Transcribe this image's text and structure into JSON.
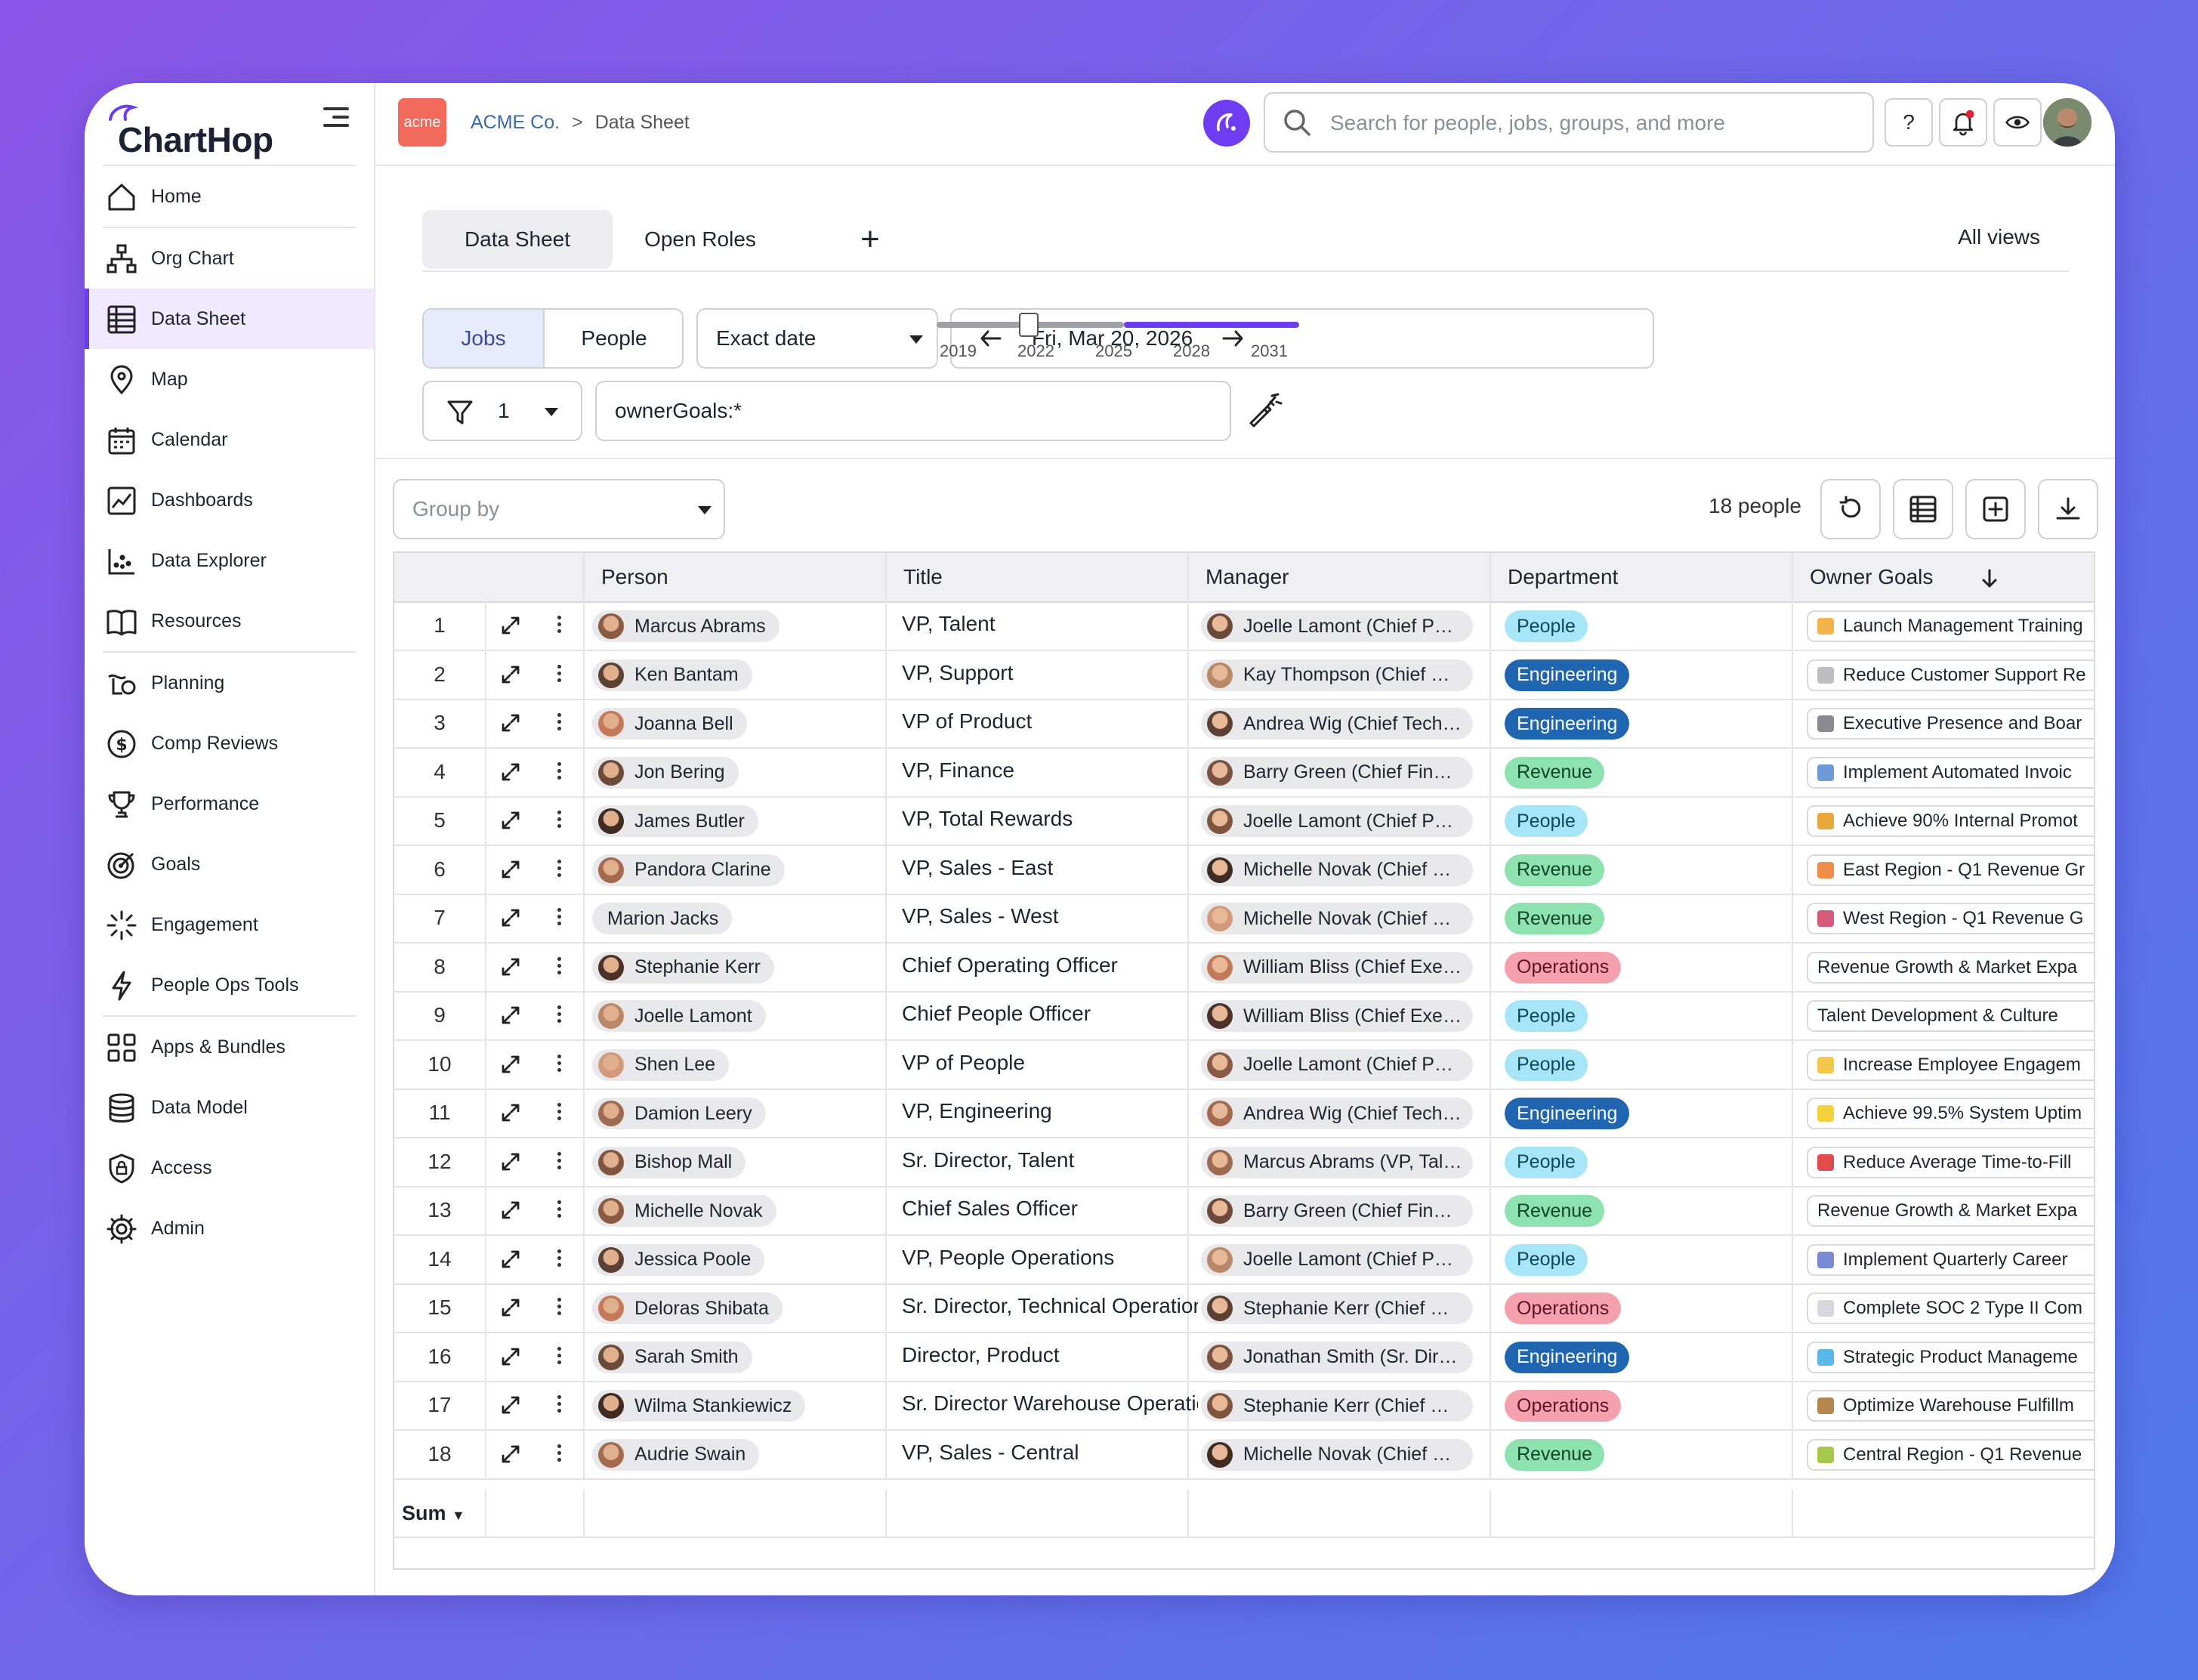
{
  "app": {
    "name": "ChartHop"
  },
  "sidebar": {
    "items": [
      {
        "label": "Home",
        "icon": "home-icon"
      },
      {
        "label": "Org Chart",
        "icon": "org-chart-icon"
      },
      {
        "label": "Data Sheet",
        "icon": "data-sheet-icon",
        "active": true
      },
      {
        "label": "Map",
        "icon": "map-pin-icon"
      },
      {
        "label": "Calendar",
        "icon": "calendar-icon"
      },
      {
        "label": "Dashboards",
        "icon": "dashboards-icon"
      },
      {
        "label": "Data Explorer",
        "icon": "data-explorer-icon"
      },
      {
        "label": "Resources",
        "icon": "book-icon"
      },
      {
        "label": "Planning",
        "icon": "planning-icon"
      },
      {
        "label": "Comp Reviews",
        "icon": "dollar-icon"
      },
      {
        "label": "Performance",
        "icon": "trophy-icon"
      },
      {
        "label": "Goals",
        "icon": "target-icon"
      },
      {
        "label": "Engagement",
        "icon": "engagement-icon"
      },
      {
        "label": "People Ops Tools",
        "icon": "lightning-icon"
      },
      {
        "label": "Apps & Bundles",
        "icon": "apps-icon"
      },
      {
        "label": "Data Model",
        "icon": "database-icon"
      },
      {
        "label": "Access",
        "icon": "shield-icon"
      },
      {
        "label": "Admin",
        "icon": "gear-icon"
      }
    ]
  },
  "header": {
    "org_logo_text": "acme",
    "breadcrumb_org": "ACME Co.",
    "breadcrumb_sep": ">",
    "breadcrumb_page": "Data Sheet",
    "search_placeholder": "Search for people, jobs, groups, and more",
    "help_label": "?"
  },
  "tabs": {
    "items": [
      "Data Sheet",
      "Open Roles"
    ],
    "add_label": "+",
    "all_views": "All views"
  },
  "controls": {
    "mode_jobs": "Jobs",
    "mode_people": "People",
    "date_mode": "Exact date",
    "date_value": "Fri, Mar 20, 2026",
    "timeline_years": [
      "2019",
      "2022",
      "2025",
      "2028",
      "2031"
    ],
    "filter_count": "1",
    "query": "ownerGoals:*",
    "group_by_placeholder": "Group by",
    "people_count": "18 people"
  },
  "table": {
    "columns": [
      "Person",
      "Title",
      "Manager",
      "Department",
      "Owner Goals"
    ],
    "sum_label": "Sum",
    "rows": [
      {
        "n": "1",
        "person": "Marcus Abrams",
        "title": "VP, Talent",
        "manager": "Joelle Lamont (Chief People Officer)",
        "dept": "People",
        "goal": "📈 Launch Management Training"
      },
      {
        "n": "2",
        "person": "Ken Bantam",
        "title": "VP, Support",
        "manager": "Kay Thompson (Chief Customer Officer)",
        "dept": "Engineering",
        "goal": "⏱ Reduce Customer Support Re"
      },
      {
        "n": "3",
        "person": "Joanna Bell",
        "title": "VP of Product",
        "manager": "Andrea Wig (Chief Technology Officer)",
        "dept": "Engineering",
        "goal": "🎤 Executive Presence and Boar"
      },
      {
        "n": "4",
        "person": "Jon Bering",
        "title": "VP, Finance",
        "manager": "Barry Green (Chief Financial Officer)",
        "dept": "Revenue",
        "goal": "🤖 Implement Automated Invoic"
      },
      {
        "n": "5",
        "person": "James Butler",
        "title": "VP, Total Rewards",
        "manager": "Joelle Lamont (Chief People Officer)",
        "dept": "People",
        "goal": "🏆 Achieve 90% Internal Promot"
      },
      {
        "n": "6",
        "person": "Pandora Clarine",
        "title": "VP, Sales - East",
        "manager": "Michelle Novak (Chief Sales Officer)",
        "dept": "Revenue",
        "goal": "🌅 East Region - Q1 Revenue Gr"
      },
      {
        "n": "7",
        "person": "Marion Jacks",
        "title": "VP, Sales - West",
        "manager": "Michelle Novak (Chief Sales Officer)",
        "dept": "Revenue",
        "goal": "🌄 West Region - Q1 Revenue G"
      },
      {
        "n": "8",
        "person": "Stephanie Kerr",
        "title": "Chief Operating Officer",
        "manager": "William Bliss (Chief Executive Officer)",
        "dept": "Operations",
        "goal": "Revenue Growth & Market Expa"
      },
      {
        "n": "9",
        "person": "Joelle Lamont",
        "title": "Chief People Officer",
        "manager": "William Bliss (Chief Executive Officer)",
        "dept": "People",
        "goal": "Talent Development & Culture"
      },
      {
        "n": "10",
        "person": "Shen Lee",
        "title": "VP of People",
        "manager": "Joelle Lamont (Chief People Officer)",
        "dept": "People",
        "goal": "😊 Increase Employee Engagem"
      },
      {
        "n": "11",
        "person": "Damion Leery",
        "title": "VP, Engineering",
        "manager": "Andrea Wig (Chief Technology Officer)",
        "dept": "Engineering",
        "goal": "⚡ Achieve 99.5% System Uptim"
      },
      {
        "n": "12",
        "person": "Bishop Mall",
        "title": "Sr. Director, Talent",
        "manager": "Marcus Abrams (VP, Talent)",
        "dept": "People",
        "goal": "⏰ Reduce Average Time-to-Fill"
      },
      {
        "n": "13",
        "person": "Michelle Novak",
        "title": "Chief Sales Officer",
        "manager": "Barry Green (Chief Financial Officer)",
        "dept": "Revenue",
        "goal": "Revenue Growth & Market Expa"
      },
      {
        "n": "14",
        "person": "Jessica Poole",
        "title": "VP, People Operations",
        "manager": "Joelle Lamont (Chief People Officer)",
        "dept": "People",
        "goal": "👥 Implement Quarterly Career"
      },
      {
        "n": "15",
        "person": "Deloras Shibata",
        "title": "Sr. Director, Technical Operations",
        "manager": "Stephanie Kerr (Chief Operating Officer)",
        "dept": "Operations",
        "goal": "🛡 Complete SOC 2 Type II Com"
      },
      {
        "n": "16",
        "person": "Sarah Smith",
        "title": "Director, Product",
        "manager": "Jonathan Smith (Sr. Director, Product)",
        "dept": "Engineering",
        "goal": "💎 Strategic Product Manageme"
      },
      {
        "n": "17",
        "person": "Wilma Stankiewicz",
        "title": "Sr. Director Warehouse Operations",
        "manager": "Stephanie Kerr (Chief Operating Officer)",
        "dept": "Operations",
        "goal": "📦 Optimize Warehouse Fulfillm"
      },
      {
        "n": "18",
        "person": "Audrie Swain",
        "title": "VP, Sales - Central",
        "manager": "Michelle Novak (Chief Sales Officer)",
        "dept": "Revenue",
        "goal": "🌽 Central Region - Q1 Revenue"
      }
    ]
  },
  "colors": {
    "accent": "#6b3df1",
    "people": "#a7e6f7",
    "engineering": "#1f65b0",
    "revenue": "#8de2b0",
    "operations": "#f4a1ad"
  }
}
